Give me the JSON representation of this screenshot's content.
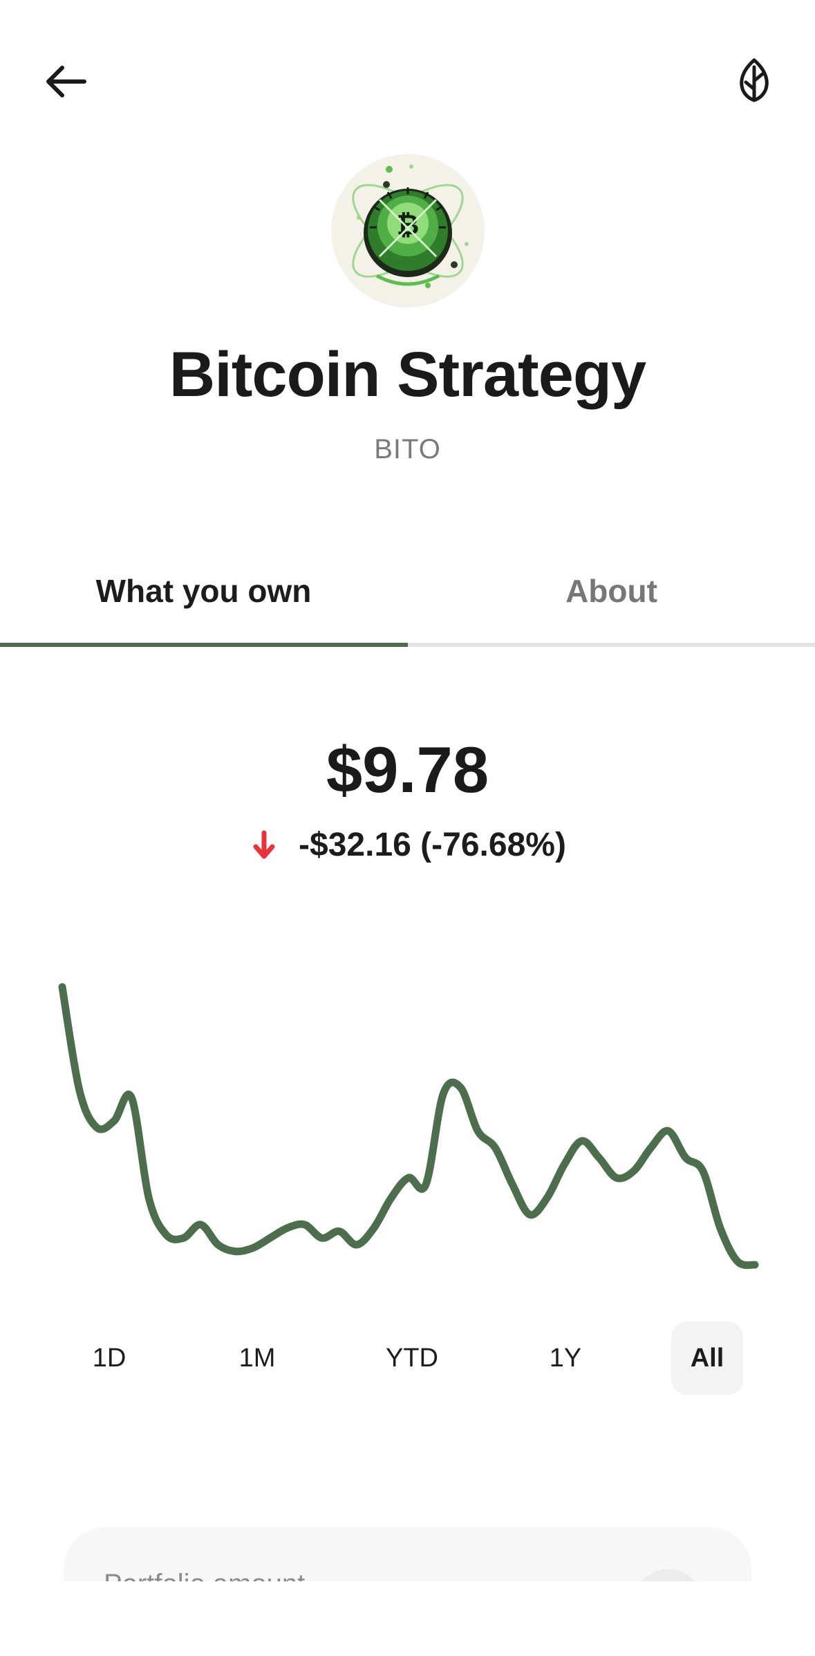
{
  "header": {
    "back_icon": "arrow-left-icon",
    "leaf_icon": "leaf-icon"
  },
  "fund": {
    "logo_icon": "bitcoin-orbit-logo",
    "name": "Bitcoin Strategy",
    "ticker": "BITO"
  },
  "tabs": [
    {
      "label": "What you own",
      "active": true
    },
    {
      "label": "About",
      "active": false
    }
  ],
  "summary": {
    "value": "$9.78",
    "change": "-$32.16 (-76.68%)",
    "direction_icon": "arrow-down-icon",
    "negative_color": "#e8333a"
  },
  "chart_data": {
    "type": "line",
    "title": "",
    "xlabel": "",
    "ylabel": "",
    "line_color": "#4c6e4c",
    "grid": false,
    "values": [
      9.9,
      6.8,
      5.7,
      5.9,
      6.6,
      3.6,
      2.5,
      2.4,
      2.8,
      2.2,
      2.0,
      2.1,
      2.4,
      2.7,
      2.8,
      2.4,
      2.6,
      2.2,
      2.7,
      3.6,
      4.2,
      4.0,
      6.7,
      6.9,
      5.6,
      5.1,
      4.0,
      3.1,
      3.6,
      4.6,
      5.3,
      4.8,
      4.2,
      4.4,
      5.1,
      5.6,
      4.8,
      4.4,
      2.7,
      1.7,
      1.6
    ]
  },
  "ranges": [
    {
      "label": "1D",
      "active": false
    },
    {
      "label": "1M",
      "active": false
    },
    {
      "label": "YTD",
      "active": false
    },
    {
      "label": "1Y",
      "active": false
    },
    {
      "label": "All",
      "active": true
    }
  ],
  "portfolio": {
    "label": "Portfolio amount"
  }
}
